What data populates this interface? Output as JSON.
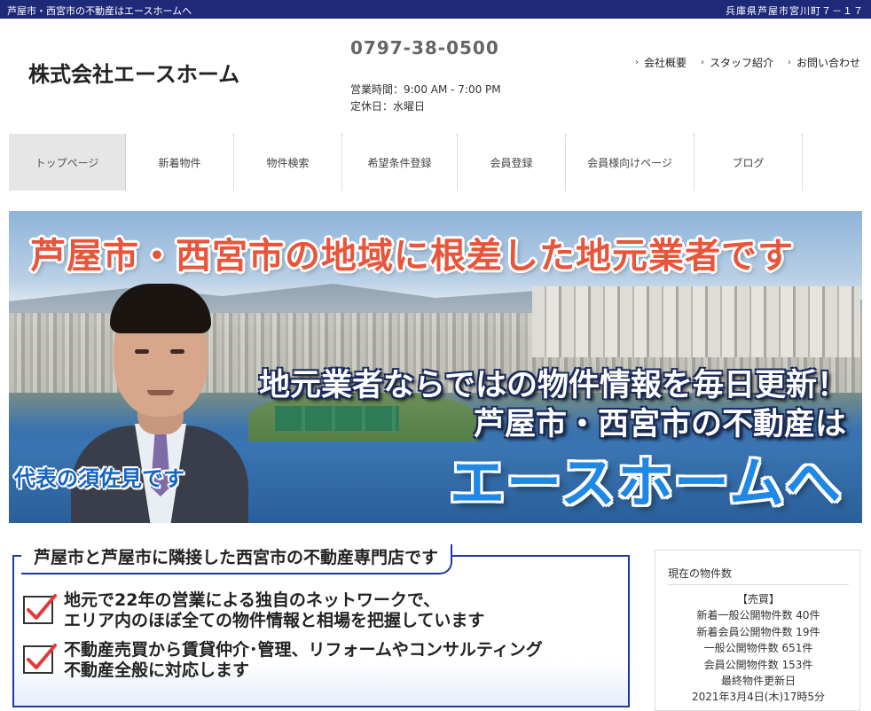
{
  "topbar": {
    "left": "芦屋市・西宮市の不動産はエースホームへ",
    "right": "兵庫県芦屋市宮川町７－１７"
  },
  "header": {
    "logo": "株式会社エースホーム",
    "phone": "0797-38-0500",
    "hours": "営業時間：9:00 AM - 7:00 PM",
    "holiday": "定休日：水曜日",
    "links": [
      "会社概要",
      "スタッフ紹介",
      "お問い合わせ"
    ]
  },
  "nav": {
    "items": [
      "トップページ",
      "新着物件",
      "物件検索",
      "希望条件登録",
      "会員登録",
      "会員様向けページ",
      "ブログ"
    ]
  },
  "hero": {
    "headline": "芦屋市・西宮市の地域に根差した地元業者です",
    "line1": "地元業者ならではの物件情報を毎日更新！",
    "line2": "芦屋市・西宮市の不動産は",
    "brand": "エースホームへ",
    "representative": "代表の須佐見です"
  },
  "feature": {
    "title": "芦屋市と芦屋市に隣接した西宮市の不動産専門店です",
    "points": [
      {
        "line1": "地元で22年の営業による独自のネットワークで、",
        "line2": "エリア内のほぼ全ての物件情報と相場を把握しています"
      },
      {
        "line1": "不動産売買から賃貸仲介･管理、リフォームやコンサルティング",
        "line2": "不動産全般に対応します"
      }
    ]
  },
  "side": {
    "heading": "現在の物件数",
    "category": "【売買】",
    "lines": [
      "新着一般公開物件数 40件",
      "新着会員公開物件数 19件",
      "一般公開物件数 651件",
      "会員公開物件数 153件",
      "最終物件更新日",
      "2021年3月4日(木)17時5分"
    ]
  },
  "colors": {
    "topbar": "#1e2a78",
    "accent_red": "#e8553a",
    "brand_blue": "#1e88e5",
    "border_blue": "#1e3a9a"
  }
}
